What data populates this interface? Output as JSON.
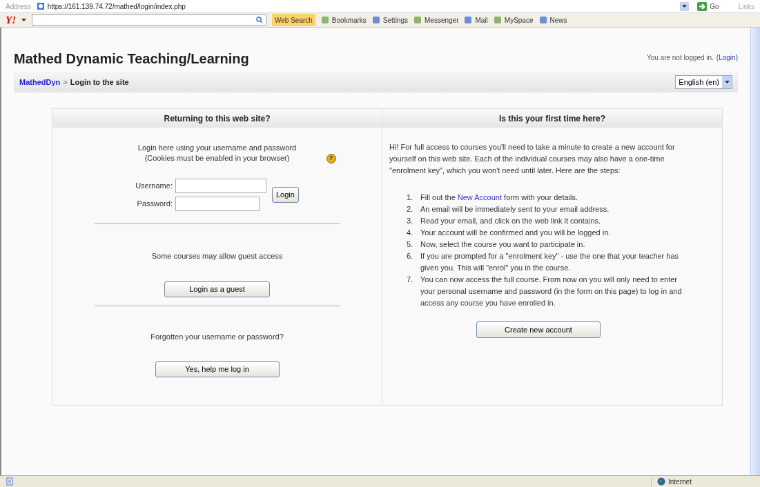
{
  "address_bar": {
    "label": "Address",
    "url": "https://161.139.74.72/mathed/login/index.php",
    "go": "Go",
    "links": "Links"
  },
  "toolbar": {
    "logo": "Y!",
    "search_button": "Web Search",
    "items": [
      {
        "label": "Bookmarks"
      },
      {
        "label": "Settings"
      },
      {
        "label": "Messenger"
      },
      {
        "label": "Mail"
      },
      {
        "label": "MySpace"
      },
      {
        "label": "News"
      }
    ]
  },
  "page": {
    "site_title": "Mathed Dynamic Teaching/Learning",
    "login_info": "You are not logged in.",
    "login_link": "(Login)",
    "breadcrumb": [
      {
        "label": "MathedDyn",
        "link": true
      },
      {
        "label": "Login to the site",
        "link": false
      }
    ],
    "breadcrumb_separator": ">",
    "language": "English (en)",
    "returning": {
      "heading": "Returning to this web site?",
      "intro": [
        "Login here using your username and password",
        "(Cookies must be enabled in your browser)"
      ],
      "help": "?",
      "username_label": "Username:",
      "password_label": "Password:",
      "login_button": "Login",
      "guest_text": "Some courses may allow guest access",
      "guest_button": "Login as a guest",
      "forgot_text": "Forgotten your username or password?",
      "forgot_button": "Yes, help me log in"
    },
    "first_time": {
      "heading": "Is this your first time here?",
      "intro": "Hi! For full access to courses you'll need to take a minute to create a new account for yourself on this web site. Each of the individual courses may also have a one-time \"enrolment key\", which you won't need until later. Here are the steps:",
      "steps": [
        {
          "number": "1.",
          "text": "Fill out the",
          "link": "New Account",
          "after": "form with your details."
        },
        {
          "number": "2.",
          "text": "An email will be immediately sent to your email address."
        },
        {
          "number": "3.",
          "text": "Read your email, and click on the web link it contains."
        },
        {
          "number": "4.",
          "text": "Your account will be confirmed and you will be logged in."
        },
        {
          "number": "5.",
          "text": "Now, select the course you want to participate in."
        },
        {
          "number": "6.",
          "text": "If you are prompted for a \"enrolment key\" - use the one that your teacher has given you. This will \"enrol\" you in the course."
        },
        {
          "number": "7.",
          "text": "You can now access the full course. From now on you will only need to enter your personal username and password (in the form on this page) to log in and access any course you have enrolled in."
        }
      ],
      "create_button": "Create new account"
    }
  },
  "status_bar": {
    "zone": "Internet"
  }
}
